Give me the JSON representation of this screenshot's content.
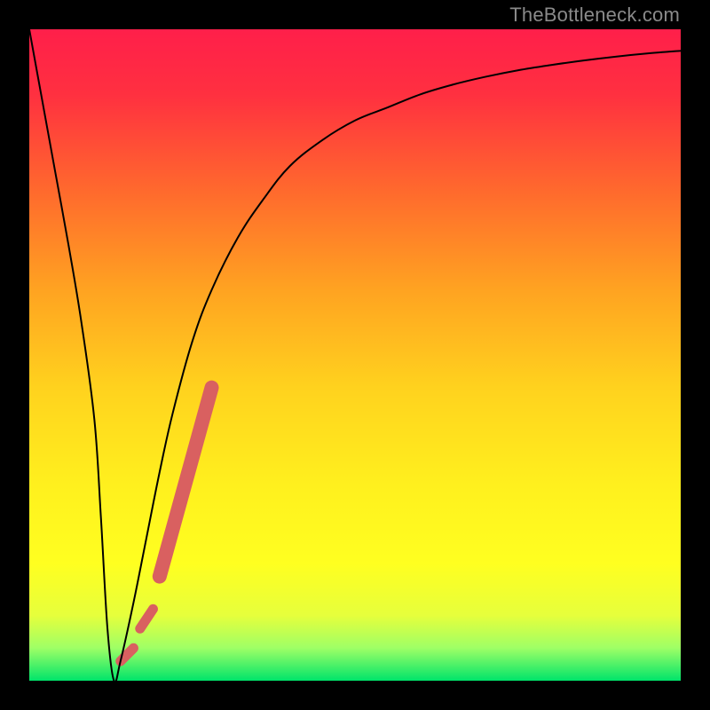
{
  "watermark": "TheBottleneck.com",
  "chart_data": {
    "type": "line",
    "title": "",
    "xlabel": "",
    "ylabel": "",
    "xlim": [
      0,
      100
    ],
    "ylim": [
      0,
      100
    ],
    "background_gradient_stops": [
      {
        "offset": 0.0,
        "color": "#ff1f4a"
      },
      {
        "offset": 0.1,
        "color": "#ff3040"
      },
      {
        "offset": 0.25,
        "color": "#ff6a2d"
      },
      {
        "offset": 0.4,
        "color": "#ffa321"
      },
      {
        "offset": 0.55,
        "color": "#ffd21e"
      },
      {
        "offset": 0.7,
        "color": "#fff01e"
      },
      {
        "offset": 0.82,
        "color": "#ffff20"
      },
      {
        "offset": 0.9,
        "color": "#e6ff3c"
      },
      {
        "offset": 0.95,
        "color": "#9eff66"
      },
      {
        "offset": 1.0,
        "color": "#00e46a"
      }
    ],
    "series": [
      {
        "name": "bottleneck-curve",
        "color": "#000000",
        "stroke_width": 2,
        "x": [
          0,
          2,
          4,
          6,
          8,
          10,
          11,
          12,
          13,
          14,
          16,
          18,
          20,
          22,
          25,
          28,
          32,
          36,
          40,
          45,
          50,
          55,
          60,
          65,
          70,
          75,
          80,
          85,
          90,
          95,
          100
        ],
        "y": [
          100,
          89,
          78,
          67,
          55,
          40,
          25,
          8,
          0,
          3,
          12,
          22,
          32,
          41,
          52,
          60,
          68,
          74,
          79,
          83,
          86,
          88,
          90,
          91.5,
          92.7,
          93.7,
          94.5,
          95.2,
          95.8,
          96.3,
          96.7
        ]
      }
    ],
    "highlight": {
      "name": "recommended-range",
      "color": "#d96060",
      "segments": [
        {
          "x1": 14,
          "y1": 3,
          "x2": 16,
          "y2": 5,
          "width": 11
        },
        {
          "x1": 17,
          "y1": 8,
          "x2": 19,
          "y2": 11,
          "width": 11
        },
        {
          "x1": 20,
          "y1": 16,
          "x2": 28,
          "y2": 45,
          "width": 16
        }
      ]
    }
  }
}
